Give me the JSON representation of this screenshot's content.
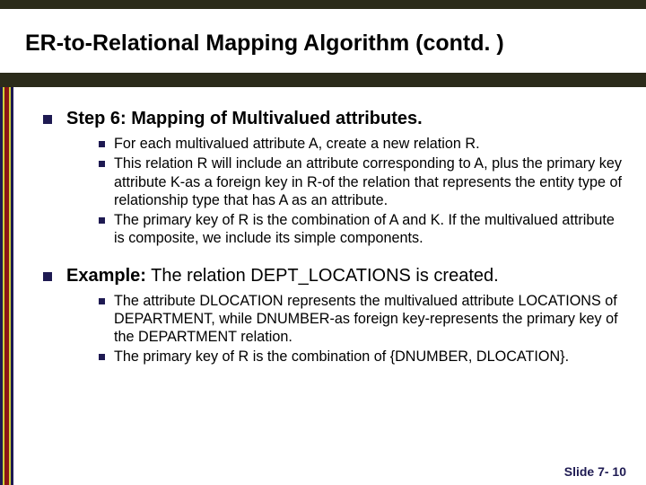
{
  "title": "ER-to-Relational Mapping Algorithm (contd. )",
  "sections": [
    {
      "heading": "Step 6: Mapping of Multivalued attributes.",
      "heading_prefix": "",
      "heading_suffix": "",
      "items": [
        "For each multivalued attribute A, create a new relation R.",
        "This relation R will include an attribute corresponding to A, plus the primary key attribute K-as a foreign key in R-of the relation that represents the entity type of relationship type that has A as an attribute.",
        "The primary key of R is the combination of A and K. If the multivalued attribute is composite, we include its simple components."
      ]
    },
    {
      "heading_prefix": "Example:",
      "heading_suffix": " The relation DEPT_LOCATIONS is created.",
      "items": [
        "The attribute DLOCATION represents the multivalued attribute LOCATIONS of DEPARTMENT, while DNUMBER-as foreign key-represents the primary key of the DEPARTMENT relation.",
        "The primary key of R is the combination of {DNUMBER, DLOCATION}."
      ]
    }
  ],
  "footer": "Slide 7- 10"
}
